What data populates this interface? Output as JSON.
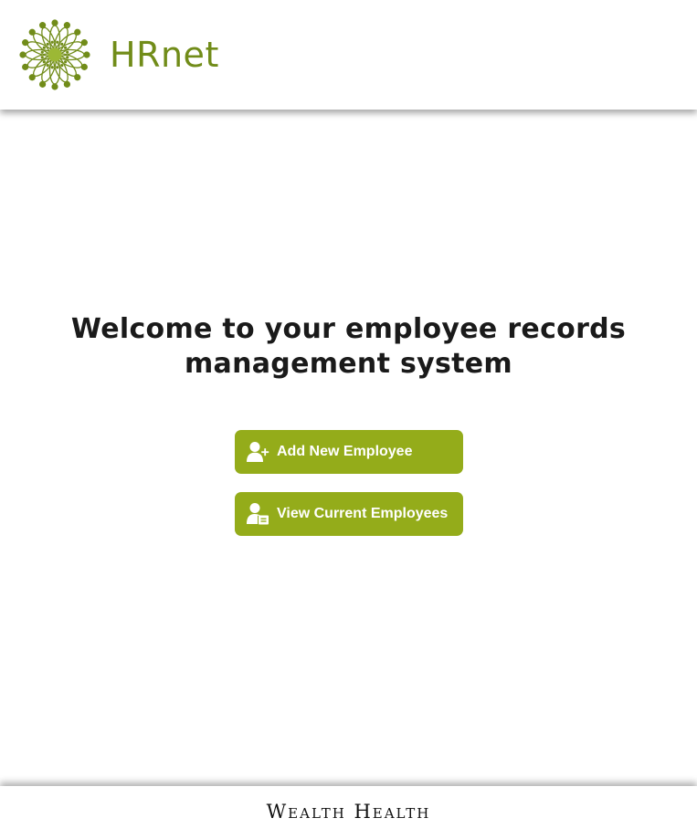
{
  "header": {
    "brand": "HRnet",
    "logo_icon": "sunburst-logo-icon",
    "accent_color": "#718c19"
  },
  "main": {
    "welcome_text": "Welcome to your employee records management system",
    "actions": [
      {
        "label": "Add New Employee",
        "icon": "add-user-icon"
      },
      {
        "label": "View Current Employees",
        "icon": "employee-list-icon"
      }
    ],
    "button_color": "#94ac1a"
  },
  "footer": {
    "brand": "Wealth Health"
  }
}
